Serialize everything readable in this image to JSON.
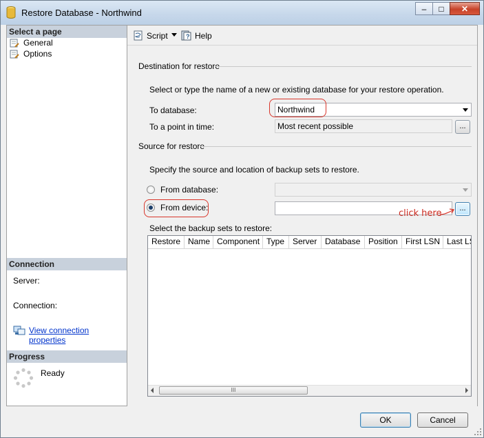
{
  "window": {
    "title": "Restore Database - Northwind",
    "controls": {
      "minimize": "–",
      "maximize": "□",
      "close": "✕"
    }
  },
  "sidebar": {
    "select_page_header": "Select a page",
    "pages": [
      {
        "label": "General",
        "icon": "page-wrench-icon",
        "selected": true
      },
      {
        "label": "Options",
        "icon": "page-wrench-icon",
        "selected": false
      }
    ],
    "connection_header": "Connection",
    "server_label": "Server:",
    "connection_label": "Connection:",
    "view_connection_properties": "View connection properties",
    "progress_header": "Progress",
    "progress_status": "Ready"
  },
  "toolbar": {
    "script_label": "Script",
    "help_label": "Help"
  },
  "destination": {
    "group_title": "Destination for restore",
    "instruction": "Select or type the name of a new or existing database for your restore operation.",
    "to_database_label": "To database:",
    "to_database_value": "Northwind",
    "point_in_time_label": "To a point in time:",
    "point_in_time_value": "Most recent possible",
    "ellipsis": "..."
  },
  "source": {
    "group_title": "Source for restore",
    "instruction": "Specify the source and location of backup sets to restore.",
    "from_database_label": "From database:",
    "from_device_label": "From device:",
    "from_device_selected": true,
    "ellipsis": "...",
    "backup_sets_label": "Select the backup sets to restore:",
    "columns": [
      "Restore",
      "Name",
      "Component",
      "Type",
      "Server",
      "Database",
      "Position",
      "First LSN",
      "Last LS"
    ],
    "scroll_grip": "III"
  },
  "annotation": {
    "click_here": "click here",
    "color": "#d8352a"
  },
  "buttons": {
    "ok": "OK",
    "cancel": "Cancel"
  },
  "colors": {
    "section_header_bg": "#c8d1dc",
    "link": "#0033cc",
    "close_button": "#c7432a"
  }
}
